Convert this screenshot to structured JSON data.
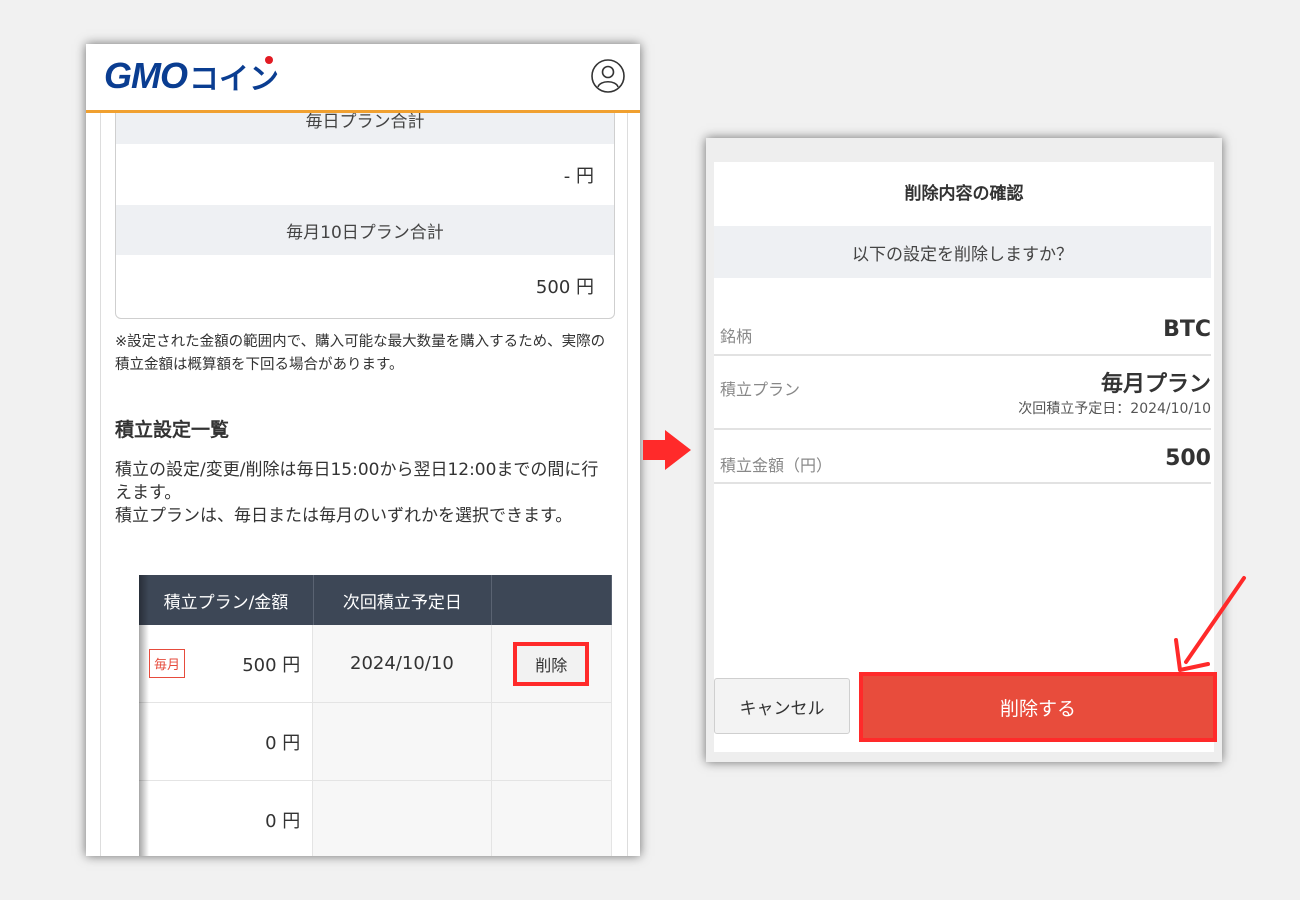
{
  "left": {
    "logo": {
      "brand": "GMO",
      "suffix": "コイン"
    },
    "summary": [
      {
        "header": "毎日プラン合計",
        "value": "- 円"
      },
      {
        "header": "毎月10日プラン合計",
        "value": "500 円"
      }
    ],
    "note": "※設定された金額の範囲内で、購入可能な最大数量を購入するため、実際の積立金額は概算額を下回る場合があります。",
    "section_title": "積立設定一覧",
    "section_desc_1": "積立の設定/変更/削除は毎日15:00から翌日12:00までの間に行えます。",
    "section_desc_2": "積立プランは、毎日または毎月のいずれかを選択できます。",
    "table": {
      "headers": [
        "積立プラン/金額",
        "次回積立予定日",
        ""
      ],
      "rows": [
        {
          "tag": "毎月",
          "amount": "500 円",
          "date": "2024/10/10",
          "action": "削除"
        },
        {
          "tag": "",
          "amount": "0 円",
          "date": "",
          "action": ""
        },
        {
          "tag": "",
          "amount": "0 円",
          "date": "",
          "action": ""
        }
      ]
    }
  },
  "right": {
    "title": "削除内容の確認",
    "question": "以下の設定を削除しますか？",
    "rows": {
      "symbol": {
        "label": "銘柄",
        "value": "BTC"
      },
      "plan": {
        "label": "積立プラン",
        "value": "毎月プラン",
        "sub": "次回積立予定日：2024/10/10"
      },
      "amount": {
        "label": "積立金額（円）",
        "value": "500"
      }
    },
    "cancel_label": "キャンセル",
    "delete_label": "削除する"
  },
  "colors": {
    "accent_orange": "#f0a030",
    "brand_blue": "#0a3d91",
    "highlight_red": "#ff2a2a",
    "delete_button": "#e84c3c",
    "table_header": "#3d4756"
  }
}
